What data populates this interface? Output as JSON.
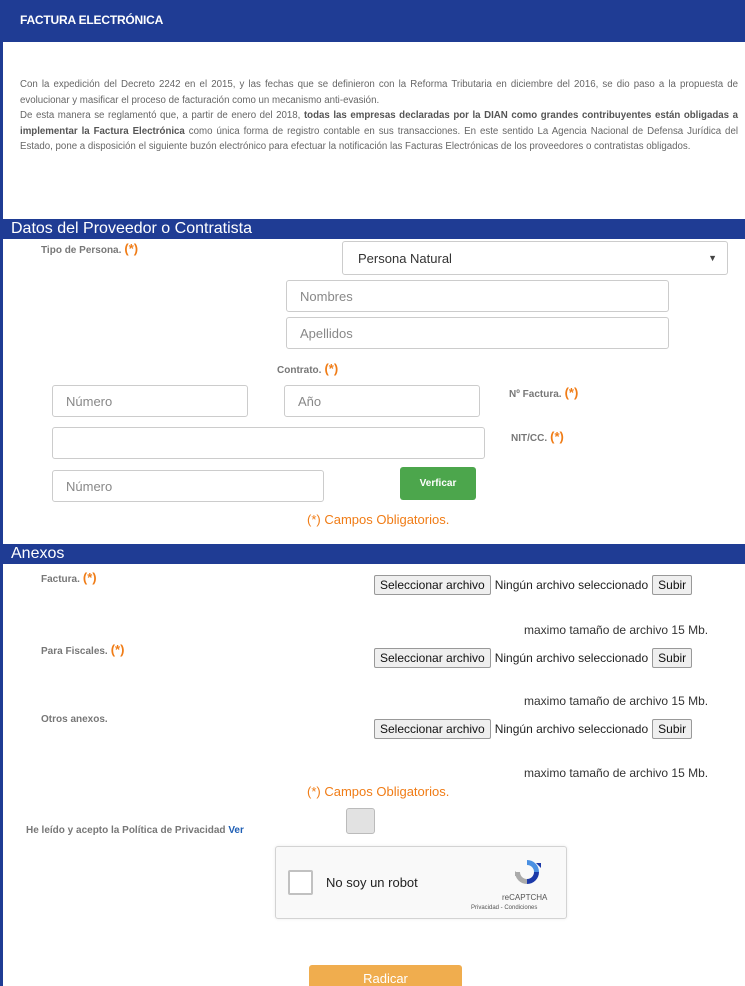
{
  "header": {
    "title": "FACTURA ELECTRÓNICA"
  },
  "intro": {
    "p1": "Con la expedición del Decreto 2242 en el 2015, y las fechas que se definieron con la Reforma Tributaria en diciembre del 2016, se dio paso a la propuesta de evolucionar y masificar el proceso de facturación como un mecanismo anti-evasión.",
    "p2_start": "De esta manera se reglamentó que, a partir de enero del 2018, ",
    "p2_bold": "todas las empresas declaradas por la DIAN como grandes contribuyentes están obligadas a implementar la Factura Electrónica",
    "p2_end": " como única forma de registro contable en sus transacciones. En este sentido La Agencia Nacional de Defensa Jurídica del Estado, pone a disposición el siguiente buzón electrónico para efectuar la notificación las Facturas Electrónicas de los proveedores o contratistas obligados."
  },
  "proveedor": {
    "section_title": "Datos del Proveedor o Contratista",
    "tipo_persona_label": "Tipo de Persona.",
    "tipo_persona_value": "Persona Natural",
    "nombres_placeholder": "Nombres",
    "apellidos_placeholder": "Apellidos",
    "contrato_label": "Contrato.",
    "numero_placeholder": "Número",
    "anio_placeholder": "Año",
    "factura_label": "Nº Factura.",
    "nit_label": "NIT/CC.",
    "nit_numero_placeholder": "Número",
    "verificar_label": "Verficar",
    "required_mark": "(*)",
    "obligatorios": "(*) Campos Obligatorios."
  },
  "anexos": {
    "section_title": "Anexos",
    "rows": [
      {
        "label": "Factura.",
        "required": true
      },
      {
        "label": "Para Fiscales.",
        "required": true
      },
      {
        "label": "Otros anexos.",
        "required": false
      }
    ],
    "select_file_label": "Seleccionar archivo",
    "no_file_label": "Ningún archivo seleccionado",
    "upload_label": "Subir",
    "max_size": "maximo tamaño de archivo 15 Mb.",
    "obligatorios": "(*) Campos Obligatorios."
  },
  "privacy": {
    "text": "He leído y acepto la Política de Privacidad",
    "link": "Ver"
  },
  "captcha": {
    "label": "No soy un robot",
    "brand": "reCAPTCHA",
    "terms": "Privacidad - Condiciones"
  },
  "submit": {
    "label": "Radicar"
  },
  "colors": {
    "primary": "#1f3c94",
    "required": "#f07c16",
    "verify": "#4ca64c",
    "submit": "#f0ad4e"
  }
}
